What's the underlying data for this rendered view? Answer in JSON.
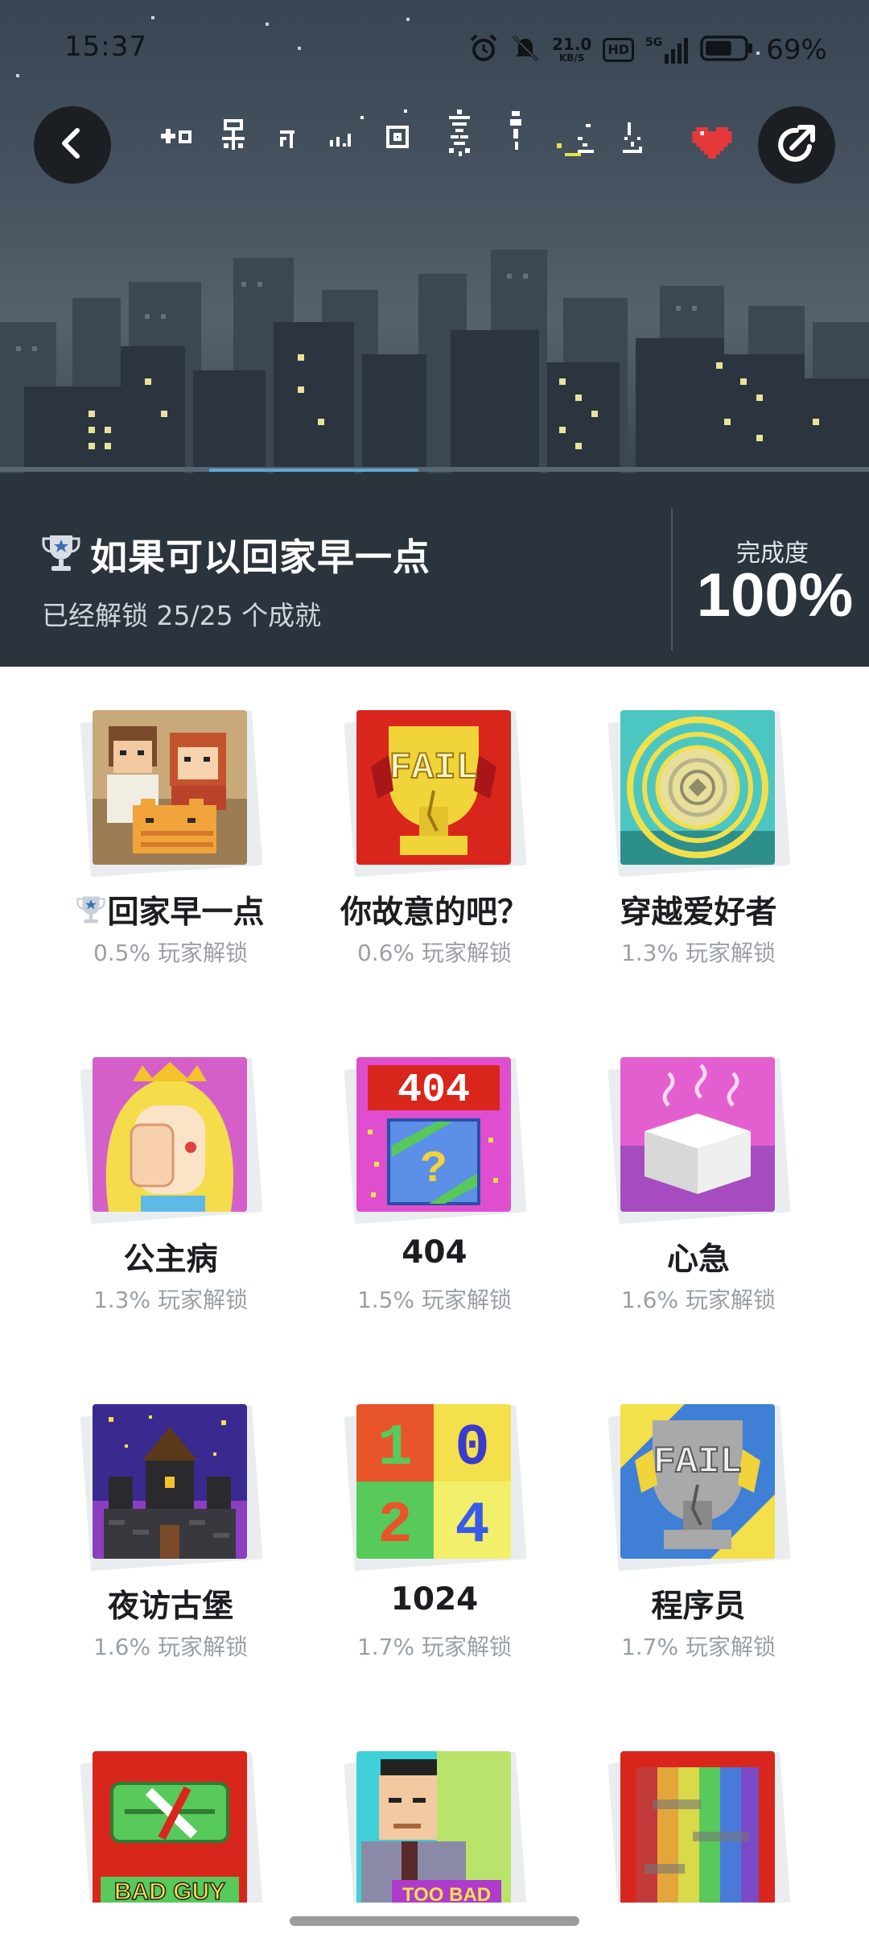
{
  "status_bar": {
    "time": "15:37",
    "net_speed_value": "21.0",
    "net_speed_unit": "KB/S",
    "hd_label": "HD",
    "signal_label": "5G",
    "battery_percent": "69%",
    "battery_level": 0.69,
    "icons": [
      "alarm-icon",
      "mute-icon",
      "network-speed",
      "hd-icon",
      "signal-icon",
      "battery-icon"
    ]
  },
  "header": {
    "back_icon": "chevron-left-icon",
    "share_icon": "share-icon",
    "favorite_icon": "heart-icon",
    "pixel_title_art": "如果可以回家早一点",
    "trophy_icon": "trophy-icon",
    "game_title": "如果可以回家早一点",
    "unlock_summary": "已经解锁 25/25 个成就",
    "completion_label": "完成度",
    "completion_value": "100%",
    "completion_fraction": 1.0
  },
  "achievements": [
    {
      "name": "回家早一点",
      "rate": "0.5% 玩家解锁",
      "trophy": true,
      "art": "couple-cat"
    },
    {
      "name": "你故意的吧？",
      "rate": "0.6% 玩家解锁",
      "trophy": false,
      "art": "fail-red"
    },
    {
      "name": "穿越爱好者",
      "rate": "1.3% 玩家解锁",
      "trophy": false,
      "art": "portal"
    },
    {
      "name": "公主病",
      "rate": "1.3% 玩家解锁",
      "trophy": false,
      "art": "princess"
    },
    {
      "name": "404",
      "rate": "1.5% 玩家解锁",
      "trophy": false,
      "art": "404-box",
      "art_text": "404"
    },
    {
      "name": "心急",
      "rate": "1.6% 玩家解锁",
      "trophy": false,
      "art": "steam-box"
    },
    {
      "name": "夜访古堡",
      "rate": "1.6% 玩家解锁",
      "trophy": false,
      "art": "castle"
    },
    {
      "name": "1024",
      "rate": "1.7% 玩家解锁",
      "trophy": false,
      "art": "1024-grid",
      "art_digits": [
        "1",
        "0",
        "2",
        "4"
      ]
    },
    {
      "name": "程序员",
      "rate": "1.7% 玩家解锁",
      "trophy": false,
      "art": "fail-grey"
    },
    {
      "name": "",
      "rate": "",
      "trophy": false,
      "art": "bad-guy",
      "art_text": "BAD GUY"
    },
    {
      "name": "",
      "rate": "",
      "trophy": false,
      "art": "too-bad",
      "art_text": "TOO BAD"
    },
    {
      "name": "",
      "rate": "",
      "trophy": false,
      "art": "rainbow"
    }
  ],
  "art_labels": {
    "fail": "FAIL",
    "question": "?"
  },
  "colors": {
    "header_bg": "#3a4553",
    "title_text": "#ffffff",
    "name_text": "#1b1d20",
    "rate_text": "#9aa0a6",
    "heart": "#e5383b"
  }
}
